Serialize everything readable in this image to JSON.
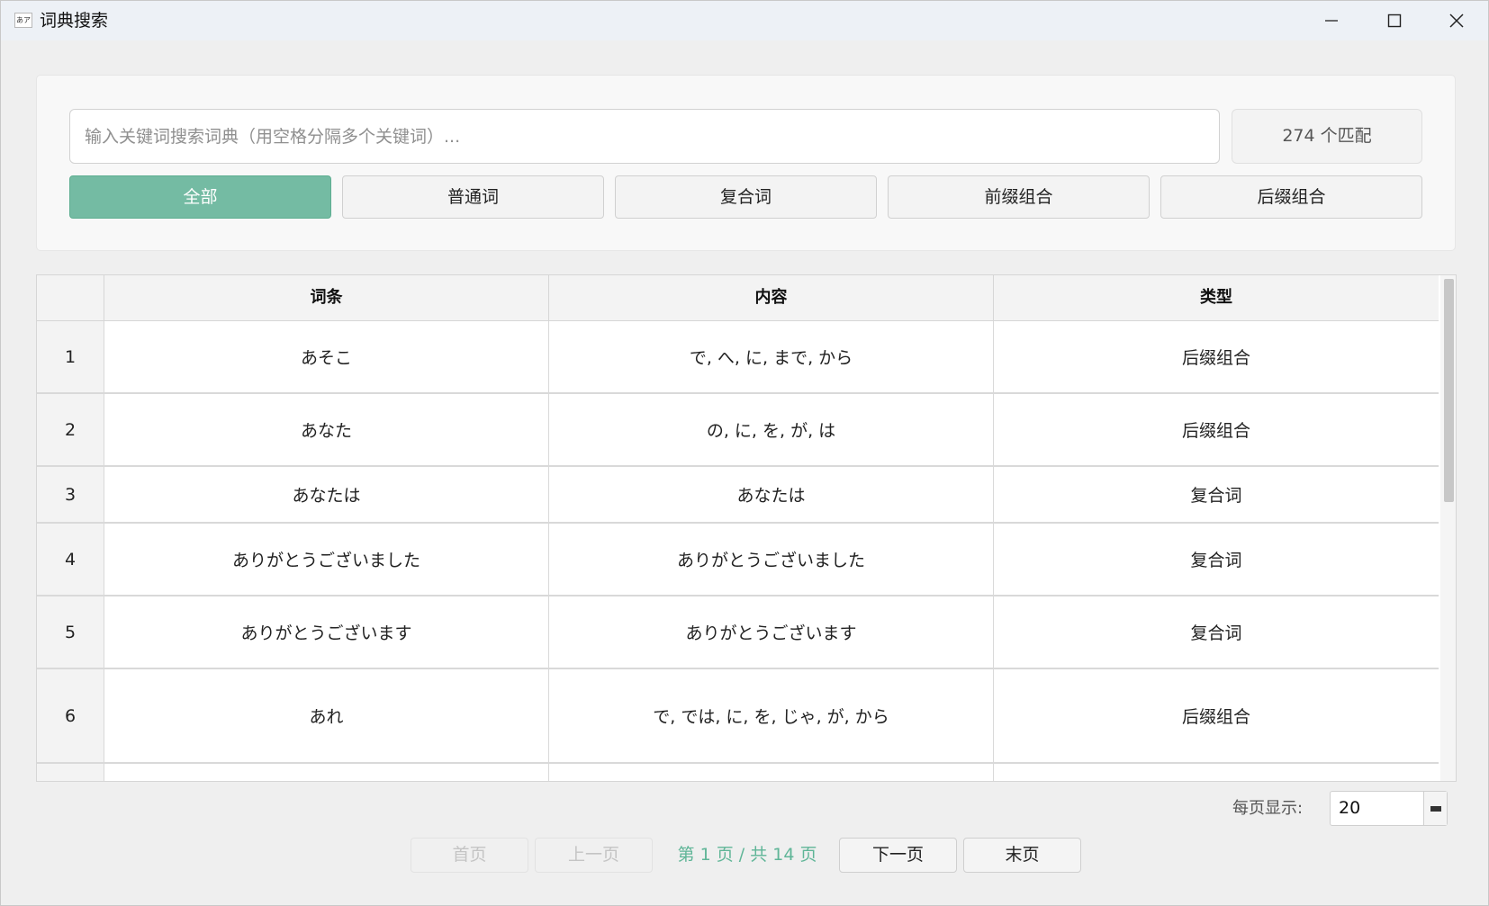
{
  "window": {
    "title": "词典搜索",
    "icon_text": "あア",
    "controls": [
      "minimize-icon",
      "maximize-icon",
      "close-icon"
    ]
  },
  "search": {
    "placeholder": "输入关键词搜索词典（用空格分隔多个关键词）...",
    "value": "",
    "match_count": "274 个匹配"
  },
  "filters": [
    {
      "label": "全部",
      "active": true
    },
    {
      "label": "普通词",
      "active": false
    },
    {
      "label": "复合词",
      "active": false
    },
    {
      "label": "前缀组合",
      "active": false
    },
    {
      "label": "后缀组合",
      "active": false
    }
  ],
  "table": {
    "headers": [
      "词条",
      "内容",
      "类型"
    ],
    "rows": [
      {
        "index": "1",
        "entry": "あそこ",
        "content": "で, へ, に, まで, から",
        "type": "后缀组合"
      },
      {
        "index": "2",
        "entry": "あなた",
        "content": "の, に, を, が, は",
        "type": "后缀组合"
      },
      {
        "index": "3",
        "entry": "あなたは",
        "content": "あなたは",
        "type": "复合词"
      },
      {
        "index": "4",
        "entry": "ありがとうございました",
        "content": "ありがとうございました",
        "type": "复合词"
      },
      {
        "index": "5",
        "entry": "ありがとうございます",
        "content": "ありがとうございます",
        "type": "复合词"
      },
      {
        "index": "6",
        "entry": "あれ",
        "content": "で, では, に, を, じゃ, が, から",
        "type": "后缀组合"
      }
    ]
  },
  "pagination": {
    "per_page_label": "每页显示:",
    "per_page_value": "20",
    "first_label": "首页",
    "prev_label": "上一页",
    "page_info": "第 1 页 / 共 14 页",
    "next_label": "下一页",
    "last_label": "末页",
    "accent_color": "#5fb597"
  },
  "colors": {
    "active_filter": "#74bba3",
    "page_info": "#5fb597"
  }
}
